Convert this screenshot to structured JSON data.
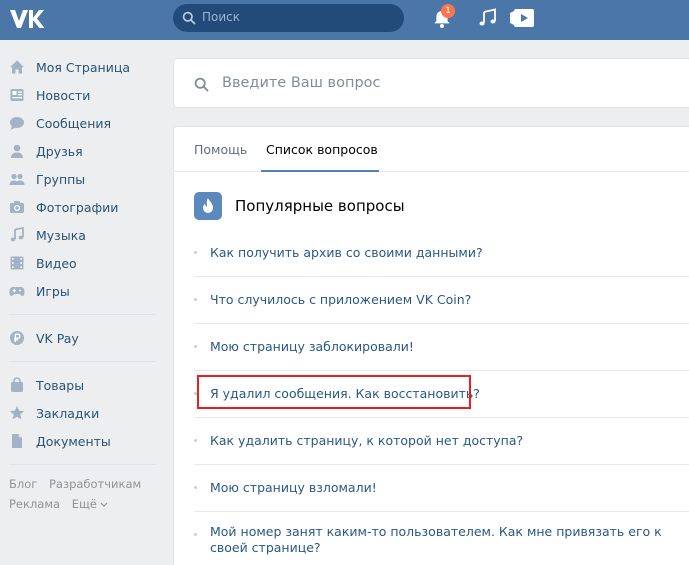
{
  "header": {
    "logo": "VK",
    "search_placeholder": "Поиск",
    "notification_count": "1",
    "colors": {
      "bar": "#4a76a8",
      "search_bg": "#224b7a",
      "badge": "#ff734c"
    }
  },
  "sidebar": {
    "items": [
      {
        "label": "Моя Страница",
        "icon": "home-icon"
      },
      {
        "label": "Новости",
        "icon": "news-icon"
      },
      {
        "label": "Сообщения",
        "icon": "chat-icon"
      },
      {
        "label": "Друзья",
        "icon": "person-icon"
      },
      {
        "label": "Группы",
        "icon": "group-icon"
      },
      {
        "label": "Фотографии",
        "icon": "camera-icon"
      },
      {
        "label": "Музыка",
        "icon": "music-note-icon"
      },
      {
        "label": "Видео",
        "icon": "film-icon"
      },
      {
        "label": "Игры",
        "icon": "gamepad-icon"
      }
    ],
    "pay": {
      "label": "VK Pay",
      "icon": "ruble-coin-icon"
    },
    "extra": [
      {
        "label": "Товары",
        "icon": "bag-icon"
      },
      {
        "label": "Закладки",
        "icon": "star-icon"
      },
      {
        "label": "Документы",
        "icon": "document-icon"
      }
    ],
    "footer": {
      "blog": "Блог",
      "dev": "Разработчикам",
      "ads": "Реклама",
      "more": "Ещё"
    }
  },
  "ask": {
    "placeholder": "Введите Ваш вопрос"
  },
  "tabs": [
    {
      "label": "Помощь",
      "active": false
    },
    {
      "label": "Список вопросов",
      "active": true
    }
  ],
  "popular": {
    "title": "Популярные вопросы",
    "icon": "fire-icon",
    "questions": [
      "Как получить архив со своими данными?",
      "Что случилось с приложением VK Coin?",
      "Мою страницу заблокировали!",
      "Я удалил сообщения. Как восстановить?",
      "Как удалить страницу, к которой нет доступа?",
      "Мою страницу взломали!",
      "Мой номер занят каким-то пользователем. Как мне привязать его к своей странице?"
    ],
    "highlighted_index": 3,
    "highlight_color": "#e8201d"
  }
}
